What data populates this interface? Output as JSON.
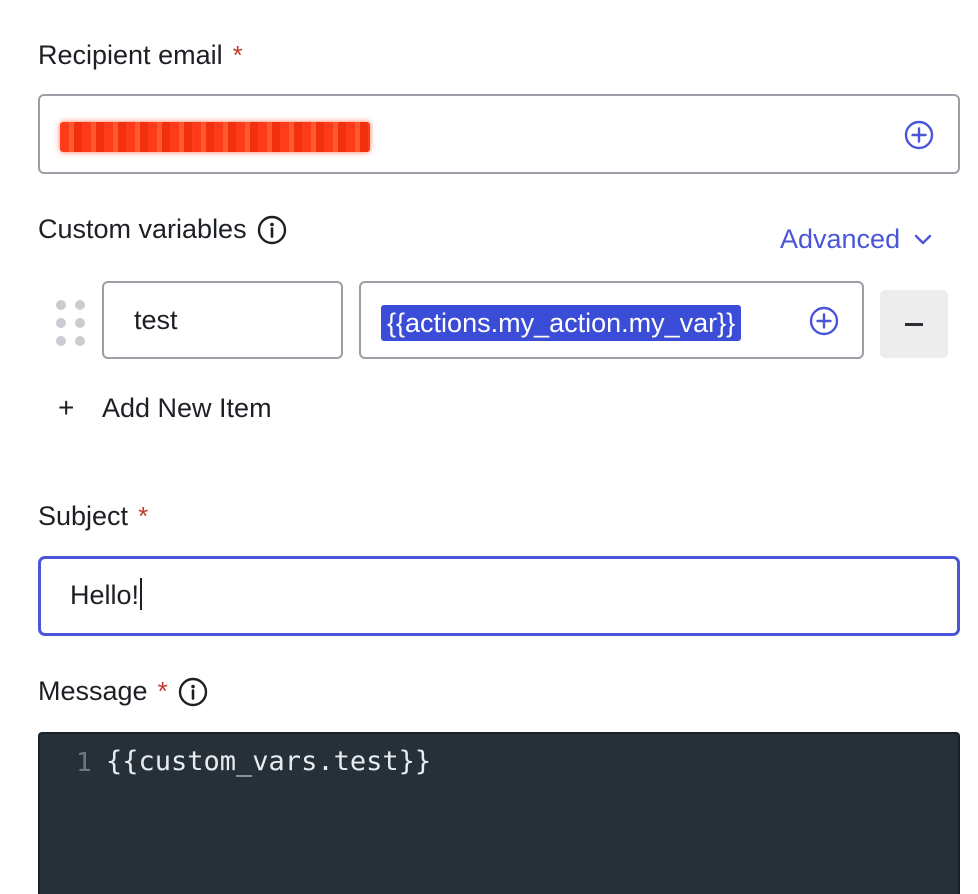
{
  "recipient": {
    "label": "Recipient email",
    "required_mark": "*"
  },
  "custom_variables": {
    "label": "Custom variables",
    "advanced_label": "Advanced",
    "items": [
      {
        "key": "test",
        "value": "{{actions.my_action.my_var}}"
      }
    ],
    "add_label": "Add New Item",
    "add_symbol": "+"
  },
  "subject": {
    "label": "Subject",
    "required_mark": "*",
    "value": "Hello!"
  },
  "message": {
    "label": "Message",
    "required_mark": "*",
    "line_number": "1",
    "code": "{{custom_vars.test}}"
  },
  "colors": {
    "accent": "#4a56d8",
    "required": "#c0392b",
    "token_bg": "#3b4cd6",
    "editor_bg": "#263038"
  },
  "icons": {
    "insert": "plus-circle-icon",
    "info": "info-icon",
    "chevron": "chevron-down-icon",
    "drag": "drag-handle-icon",
    "remove": "minus-icon"
  }
}
